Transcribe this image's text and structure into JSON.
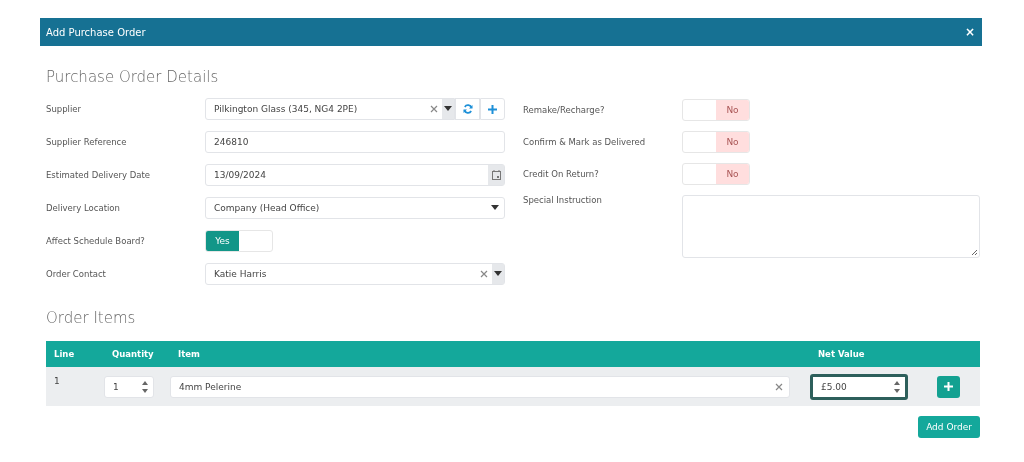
{
  "dialog": {
    "title": "Add Purchase Order",
    "close": "×"
  },
  "details": {
    "heading": "Purchase Order Details",
    "left": [
      {
        "label": "Supplier",
        "kind": "combo-actions",
        "value": "Pilkington Glass (345, NG4 2PE)"
      },
      {
        "label": "Supplier Reference",
        "kind": "text",
        "value": "246810"
      },
      {
        "label": "Estimated Delivery Date",
        "kind": "date",
        "value": "13/09/2024"
      },
      {
        "label": "Delivery Location",
        "kind": "select",
        "value": "Company (Head Office)"
      },
      {
        "label": "Affect Schedule Board?",
        "kind": "toggle",
        "toggle": {
          "label": "Yes",
          "on": true
        }
      },
      {
        "label": "Order Contact",
        "kind": "combo",
        "value": "Katie Harris"
      }
    ],
    "right": [
      {
        "label": "Remake/Recharge?",
        "kind": "toggle",
        "toggle": {
          "label": "No",
          "on": false
        }
      },
      {
        "label": "Confirm & Mark as Delivered",
        "kind": "toggle",
        "toggle": {
          "label": "No",
          "on": false
        }
      },
      {
        "label": "Credit On Return?",
        "kind": "toggle",
        "toggle": {
          "label": "No",
          "on": false
        }
      },
      {
        "label": "Special Instruction",
        "kind": "textarea"
      }
    ]
  },
  "items": {
    "heading": "Order Items",
    "columns": [
      "Line",
      "Quantity",
      "Item",
      "Net Value"
    ],
    "rows": [
      {
        "line": "1",
        "quantity": "1",
        "item": "4mm Pelerine",
        "net_value": "£5.00",
        "net_value_focused": true
      }
    ],
    "add_order": "Add Order"
  }
}
